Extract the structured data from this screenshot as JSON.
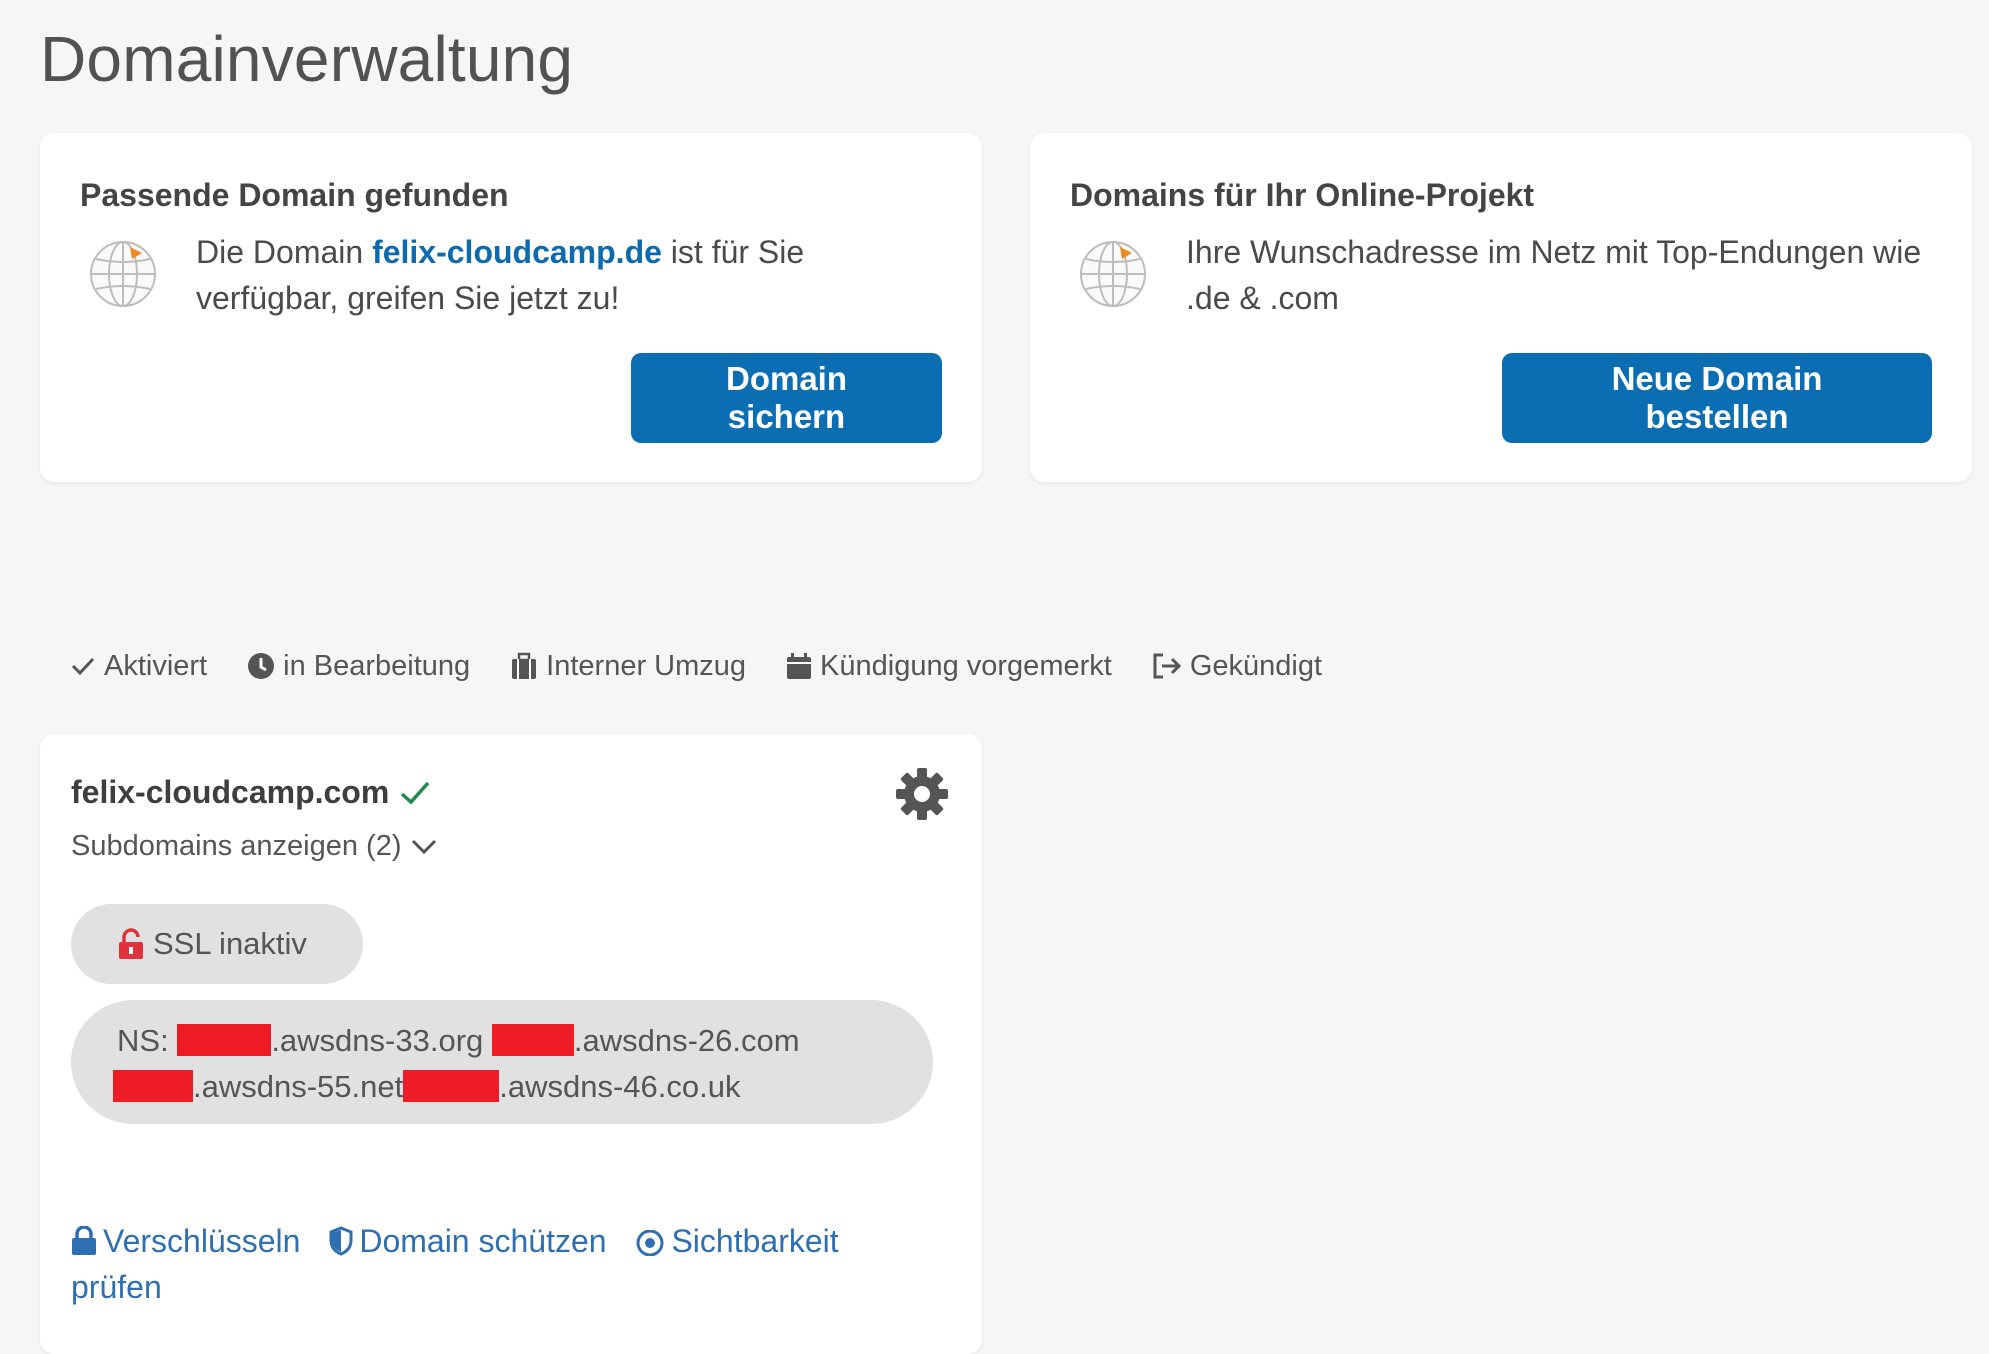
{
  "page": {
    "title": "Domainverwaltung"
  },
  "promo_left": {
    "heading": "Passende Domain gefunden",
    "text_before": "Die Domain ",
    "domain_link": "felix-cloudcamp.de",
    "text_after": " ist für Sie verfügbar, greifen Sie jetzt zu!",
    "button_label": "Domain sichern",
    "icon": "globe-icon"
  },
  "promo_right": {
    "heading": "Domains für Ihr Online-Projekt",
    "text": "Ihre Wunschadresse im Netz mit Top-Endungen wie .de & .com",
    "button_label": "Neue Domain bestellen",
    "icon": "globe-icon"
  },
  "legend": {
    "items": [
      {
        "label": "Aktiviert",
        "icon": "check-icon"
      },
      {
        "label": "in Bearbeitung",
        "icon": "clock-icon"
      },
      {
        "label": "Interner Umzug",
        "icon": "suitcase-icon"
      },
      {
        "label": "Kündigung vorgemerkt",
        "icon": "calendar-icon"
      },
      {
        "label": "Gekündigt",
        "icon": "sign-out-icon"
      }
    ]
  },
  "domain_card": {
    "domain": "felix-cloudcamp.com",
    "status_icon": "check-icon",
    "subdomains_label": "Subdomains anzeigen (2)",
    "ssl_label": "SSL inaktiv",
    "ns": {
      "prefix": "NS:",
      "entries": [
        ".awsdns-33.org",
        ".awsdns-26.com",
        ".awsdns-55.net",
        ".awsdns-46.co.uk"
      ]
    },
    "actions": {
      "encrypt": "Verschlüsseln",
      "protect": "Domain schützen",
      "visibility": "Sichtbarkeit prüfen"
    }
  },
  "colors": {
    "primary_button": "#0b6db2",
    "link": "#0d6aad",
    "action_link": "#2d6fb0",
    "status_green": "#1e8a4c",
    "ssl_red": "#e0323c",
    "redaction": "#ee1c25",
    "pill_bg": "#e1e1e1",
    "page_bg": "#f6f6f6"
  }
}
